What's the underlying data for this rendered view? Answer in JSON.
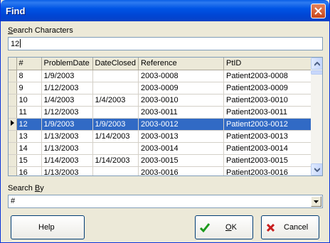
{
  "window": {
    "title": "Find"
  },
  "search": {
    "label_u": "S",
    "label_rest": "earch Characters",
    "value": "12"
  },
  "grid": {
    "headers": [
      "#",
      "ProblemDate",
      "DateClosed",
      "Reference",
      "PtID"
    ],
    "rows": [
      [
        "8",
        "1/9/2003",
        "",
        "2003-0008",
        "Patient2003-0008"
      ],
      [
        "9",
        "1/12/2003",
        "",
        "2003-0009",
        "Patient2003-0009"
      ],
      [
        "10",
        "1/4/2003",
        "1/4/2003",
        "2003-0010",
        "Patient2003-0010"
      ],
      [
        "11",
        "1/12/2003",
        "",
        "2003-0011",
        "Patient2003-0011"
      ],
      [
        "12",
        "1/9/2003",
        "1/9/2003",
        "2003-0012",
        "Patient2003-0012"
      ],
      [
        "13",
        "1/13/2003",
        "1/14/2003",
        "2003-0013",
        "Patient2003-0013"
      ],
      [
        "14",
        "1/13/2003",
        "",
        "2003-0014",
        "Patient2003-0014"
      ],
      [
        "15",
        "1/14/2003",
        "1/14/2003",
        "2003-0015",
        "Patient2003-0015"
      ],
      [
        "16",
        "1/13/2003",
        "",
        "2003-0016",
        "Patient2003-0016"
      ]
    ],
    "selected_row": 4
  },
  "search_by": {
    "label_pre": "Search ",
    "label_u": "B",
    "label_post": "y",
    "value": "#"
  },
  "buttons": {
    "help": "Help",
    "ok_u": "O",
    "ok_rest": "K",
    "cancel": "Cancel"
  },
  "colors": {
    "selection": "#316AC5",
    "ok_check": "#1C9A1C",
    "cancel_x": "#C81E1E"
  }
}
